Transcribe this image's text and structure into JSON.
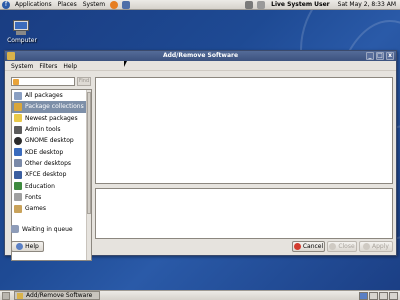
{
  "top_panel": {
    "menus": [
      "Applications",
      "Places",
      "System"
    ],
    "user": "Live System User",
    "clock": "Sat May  2,  8:33 AM"
  },
  "desktop": {
    "computer_label": "Computer"
  },
  "window": {
    "title": "Add/Remove Software",
    "menus": [
      "System",
      "Filters",
      "Help"
    ],
    "search_placeholder": "",
    "find_label": "Find",
    "groups": [
      {
        "label": "All packages",
        "icon": "packages-icon",
        "color": "#8a9fc2"
      },
      {
        "label": "Package collections",
        "icon": "collections-icon",
        "color": "#d9a63a"
      },
      {
        "label": "Newest packages",
        "icon": "new-icon",
        "color": "#e9c94a"
      },
      {
        "label": "Admin tools",
        "icon": "admin-tools-icon",
        "color": "#5b5b5b"
      },
      {
        "label": "GNOME desktop",
        "icon": "gnome-icon",
        "color": "#2b2b2b"
      },
      {
        "label": "KDE desktop",
        "icon": "kde-icon",
        "color": "#3a6bbd"
      },
      {
        "label": "Other desktops",
        "icon": "other-desktops-icon",
        "color": "#7b8aa8"
      },
      {
        "label": "XFCE desktop",
        "icon": "xfce-icon",
        "color": "#3b5fa0"
      },
      {
        "label": "Education",
        "icon": "education-icon",
        "color": "#3e8a3e"
      },
      {
        "label": "Fonts",
        "icon": "fonts-icon",
        "color": "#a0a0a0"
      },
      {
        "label": "Games",
        "icon": "games-icon",
        "color": "#c9a25a"
      }
    ],
    "selected_group": 1,
    "status": "Waiting in queue",
    "buttons": {
      "help": "Help",
      "cancel": "Cancel",
      "close": "Close",
      "apply": "Apply"
    }
  },
  "bottom_panel": {
    "task": "Add/Remove Software"
  }
}
